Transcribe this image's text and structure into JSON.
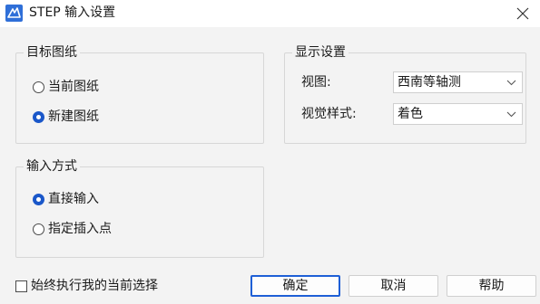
{
  "window": {
    "title": "STEP 输入设置",
    "app_icon": "app-logo-icon",
    "close_icon": "close-icon"
  },
  "target_drawing": {
    "title": "目标图纸",
    "options": [
      {
        "label": "当前图纸",
        "selected": false
      },
      {
        "label": "新建图纸",
        "selected": true
      }
    ]
  },
  "display_settings": {
    "title": "显示设置",
    "view_label": "视图:",
    "view_value": "西南等轴测",
    "visual_style_label": "视觉样式:",
    "visual_style_value": "着色"
  },
  "input_method": {
    "title": "输入方式",
    "options": [
      {
        "label": "直接输入",
        "selected": true
      },
      {
        "label": "指定插入点",
        "selected": false
      }
    ]
  },
  "footer": {
    "always_apply_label": "始终执行我的当前选择",
    "always_apply_checked": false,
    "ok_label": "确定",
    "cancel_label": "取消",
    "help_label": "帮助"
  },
  "colors": {
    "accent": "#1a57c9",
    "default_button_border": "#1e5fd6",
    "dialog_bg": "#f3f3f3"
  }
}
